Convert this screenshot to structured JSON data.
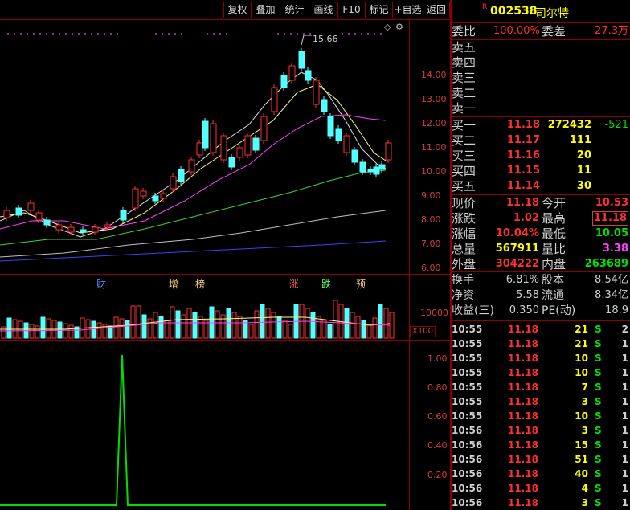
{
  "toolbar": {
    "items": [
      "复权",
      "叠加",
      "统计",
      "画线",
      "F10",
      "标记",
      "+自选",
      "返回"
    ]
  },
  "stock": {
    "code_badge": "R",
    "code": "002538",
    "name": "司尔特"
  },
  "colors": {
    "up": "#ff3030",
    "down": "#00e000",
    "volume_label": "#ffff00",
    "cyan": "#54ffff"
  },
  "price_axis": [
    "14.00",
    "13.00",
    "12.00",
    "11.00",
    "10.00",
    "9.00",
    "8.00",
    "7.00",
    "6.00"
  ],
  "high_label": "15.66",
  "events": [
    {
      "text": "财",
      "color": "#5b9bff"
    },
    {
      "text": "增",
      "color": "#ffd080"
    },
    {
      "text": "榜",
      "color": "#ffd080"
    },
    {
      "text": "涨",
      "color": "#ff6060"
    },
    {
      "text": "跌",
      "color": "#60ff60"
    },
    {
      "text": "预",
      "color": "#ffd080"
    }
  ],
  "volume_axis": {
    "level": "10000",
    "unit": "X100"
  },
  "indicator_axis": [
    "1.00",
    "0.80",
    "0.60",
    "0.40",
    "0.20"
  ],
  "quote": {
    "weibi_label": "委比",
    "weibi_value": "100.00%",
    "weicha_label": "委差",
    "weicha_value": "27.3万",
    "asks": [
      {
        "label": "卖五"
      },
      {
        "label": "卖四"
      },
      {
        "label": "卖三"
      },
      {
        "label": "卖二"
      },
      {
        "label": "卖一"
      }
    ],
    "bids": [
      {
        "label": "买一",
        "price": "11.18",
        "vol": "272432",
        "chg": "-521"
      },
      {
        "label": "买二",
        "price": "11.17",
        "vol": "111",
        "chg": ""
      },
      {
        "label": "买三",
        "price": "11.16",
        "vol": "20",
        "chg": ""
      },
      {
        "label": "买四",
        "price": "11.15",
        "vol": "11",
        "chg": ""
      },
      {
        "label": "买五",
        "price": "11.14",
        "vol": "30",
        "chg": ""
      }
    ],
    "stats": [
      {
        "l1": "现价",
        "v1": "11.18",
        "l2": "今开",
        "v2": "10.53"
      },
      {
        "l1": "涨跌",
        "v1": "1.02",
        "l2": "最高",
        "v2": "11.18"
      },
      {
        "l1": "涨幅",
        "v1": "10.04%",
        "l2": "最低",
        "v2": "10.05"
      },
      {
        "l1": "总量",
        "v1": "567911",
        "l2": "量比",
        "v2": "3.38"
      },
      {
        "l1": "外盘",
        "v1": "304222",
        "l2": "内盘",
        "v2": "263689"
      }
    ],
    "stats2": [
      {
        "l1": "换手",
        "v1": "6.81%",
        "l2": "股本",
        "v2": "8.54亿"
      },
      {
        "l1": "净资",
        "v1": "5.58",
        "l2": "流通",
        "v2": "8.34亿"
      },
      {
        "l1": "收益(三)",
        "v1": "0.350",
        "l2": "PE(动)",
        "v2": "18.9"
      }
    ]
  },
  "ticks": [
    {
      "time": "10:55",
      "price": "11.18",
      "vol": "21",
      "side": "S",
      "n": "2"
    },
    {
      "time": "10:55",
      "price": "11.18",
      "vol": "21",
      "side": "S",
      "n": "1"
    },
    {
      "time": "10:55",
      "price": "11.18",
      "vol": "10",
      "side": "S",
      "n": "1"
    },
    {
      "time": "10:55",
      "price": "11.18",
      "vol": "10",
      "side": "S",
      "n": "1"
    },
    {
      "time": "10:55",
      "price": "11.18",
      "vol": "7",
      "side": "S",
      "n": "1"
    },
    {
      "time": "10:55",
      "price": "11.18",
      "vol": "3",
      "side": "S",
      "n": "1"
    },
    {
      "time": "10:55",
      "price": "11.18",
      "vol": "10",
      "side": "S",
      "n": "1"
    },
    {
      "time": "10:56",
      "price": "11.18",
      "vol": "3",
      "side": "S",
      "n": "1"
    },
    {
      "time": "10:56",
      "price": "11.18",
      "vol": "15",
      "side": "S",
      "n": "1"
    },
    {
      "time": "10:56",
      "price": "11.18",
      "vol": "51",
      "side": "S",
      "n": "1"
    },
    {
      "time": "10:56",
      "price": "11.18",
      "vol": "40",
      "side": "S",
      "n": "1"
    },
    {
      "time": "10:56",
      "price": "11.18",
      "vol": "4",
      "side": "S",
      "n": "1"
    },
    {
      "time": "10:56",
      "price": "11.18",
      "vol": "3",
      "side": "S",
      "n": "1"
    }
  ]
}
